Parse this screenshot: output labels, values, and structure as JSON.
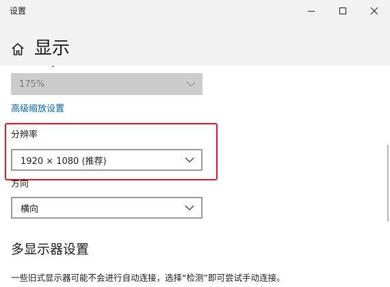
{
  "window": {
    "title": "设置",
    "controls": {
      "minimize": "minimize-icon",
      "maximize": "maximize-icon",
      "close": "close-icon"
    }
  },
  "header": {
    "home_icon": "home-icon",
    "page_title": "显示"
  },
  "scale": {
    "value": "175%",
    "disabled": true
  },
  "advanced_scaling_link": "高级缩放设置",
  "resolution": {
    "label": "分辨率",
    "value": "1920 × 1080 (推荐)"
  },
  "orientation": {
    "label": "方向",
    "value": "横向"
  },
  "multi_display": {
    "heading": "多显示器设置",
    "description": "一些旧式显示器可能不会进行自动连接，选择“检测”即可尝试手动连接。"
  },
  "colors": {
    "accent_link": "#0067b8",
    "highlight": "#e5141d",
    "header_bg": "#f2f2f2",
    "disabled_dropdown_bg": "#cccccc"
  }
}
